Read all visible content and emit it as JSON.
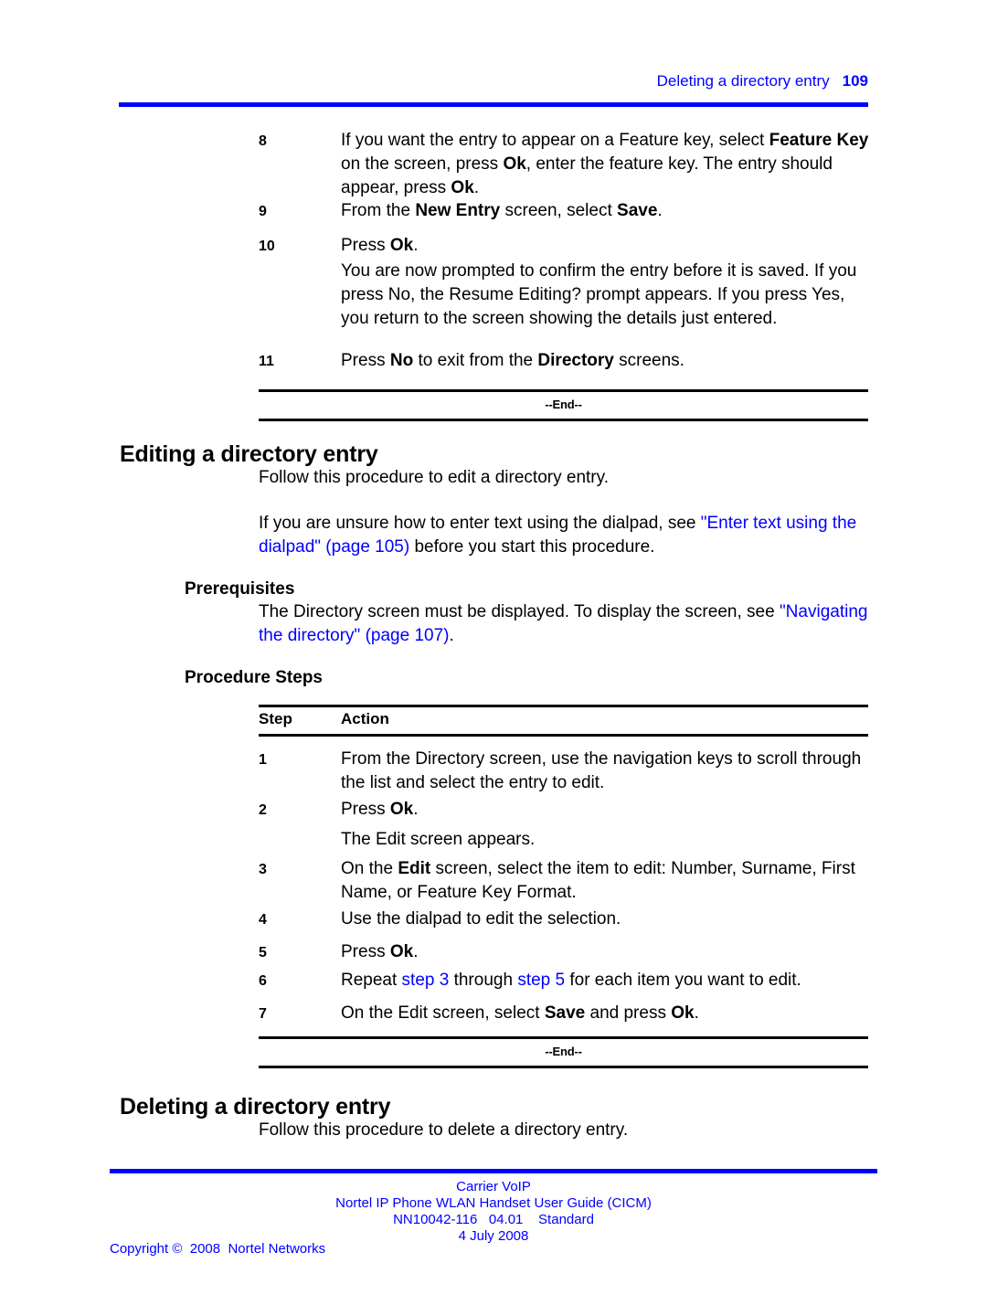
{
  "header": {
    "chapter_title": "Deleting a directory entry",
    "page_number": "109"
  },
  "continued_procedure": {
    "steps": [
      {
        "number": "8",
        "segments": [
          {
            "text": "If you want the entry to appear on a Feature key, select ",
            "style": "normal"
          },
          {
            "text": "Feature Key",
            "style": "bold"
          },
          {
            "text": " on the screen, press ",
            "style": "normal"
          },
          {
            "text": "Ok",
            "style": "bold"
          },
          {
            "text": ", enter the feature key. The entry should appear, press ",
            "style": "normal"
          },
          {
            "text": "Ok",
            "style": "bold"
          },
          {
            "text": ".",
            "style": "normal"
          }
        ]
      },
      {
        "number": "9",
        "segments": [
          {
            "text": "From the ",
            "style": "normal"
          },
          {
            "text": "New Entry",
            "style": "bold"
          },
          {
            "text": " screen, select ",
            "style": "normal"
          },
          {
            "text": "Save",
            "style": "bold"
          },
          {
            "text": ".",
            "style": "normal"
          }
        ]
      },
      {
        "number": "10",
        "segments": [
          {
            "text": "Press ",
            "style": "normal"
          },
          {
            "text": "Ok",
            "style": "bold"
          },
          {
            "text": ".",
            "style": "normal"
          }
        ]
      },
      {
        "number": "11",
        "segments": [
          {
            "text": "Press ",
            "style": "normal"
          },
          {
            "text": "No",
            "style": "bold"
          },
          {
            "text": " to exit from the ",
            "style": "normal"
          },
          {
            "text": "Directory",
            "style": "bold"
          },
          {
            "text": " screens.",
            "style": "normal"
          }
        ]
      }
    ],
    "step10_note": "You are now prompted to confirm the entry before it is saved. If you press No, the Resume Editing? prompt appears. If you press Yes, you return to the screen showing the details just entered.",
    "end_label": "--End--"
  },
  "editing_section": {
    "heading": "Editing a directory entry",
    "intro": "Follow this procedure to edit a directory entry.",
    "dialpad_note": {
      "lead": "If you are unsure how to enter text using the dialpad, see ",
      "link": "\"Enter text using the dialpad\" (page 105)",
      "tail": " before you start this procedure."
    },
    "prerequisites_heading": "Prerequisites",
    "prerequisites_text": {
      "lead": "The Directory screen must be displayed. To display the screen, see ",
      "link": "\"Navigating the directory\" (page 107)",
      "tail": "."
    },
    "procedure_heading": "Procedure Steps",
    "table": {
      "columns": [
        "Step",
        "Action"
      ],
      "rows": [
        {
          "number": "1",
          "segments": [
            {
              "text": "From the Directory screen, use the navigation keys to scroll through the list and select the entry to edit.",
              "style": "normal"
            }
          ]
        },
        {
          "number": "2",
          "segments": [
            {
              "text": "Press ",
              "style": "normal"
            },
            {
              "text": "Ok",
              "style": "bold"
            },
            {
              "text": ".",
              "style": "normal"
            }
          ]
        },
        {
          "number": "3",
          "segments": [
            {
              "text": "On the ",
              "style": "normal"
            },
            {
              "text": "Edit",
              "style": "bold"
            },
            {
              "text": " screen, select the item to edit: Number, Surname, First Name, or Feature Key Format.",
              "style": "normal"
            }
          ]
        },
        {
          "number": "4",
          "segments": [
            {
              "text": "Use the dialpad to edit the selection.",
              "style": "normal"
            }
          ]
        },
        {
          "number": "5",
          "segments": [
            {
              "text": "Press ",
              "style": "normal"
            },
            {
              "text": "Ok",
              "style": "bold"
            },
            {
              "text": ".",
              "style": "normal"
            }
          ]
        },
        {
          "number": "6",
          "segments": [
            {
              "text": "Repeat ",
              "style": "normal"
            },
            {
              "text": "step 3",
              "style": "link"
            },
            {
              "text": " through ",
              "style": "normal"
            },
            {
              "text": "step 5",
              "style": "link"
            },
            {
              "text": " for each item you want to edit.",
              "style": "normal"
            }
          ]
        },
        {
          "number": "7",
          "segments": [
            {
              "text": "On the Edit screen, select ",
              "style": "normal"
            },
            {
              "text": "Save",
              "style": "bold"
            },
            {
              "text": " and press ",
              "style": "normal"
            },
            {
              "text": "Ok",
              "style": "bold"
            },
            {
              "text": ".",
              "style": "normal"
            }
          ]
        }
      ]
    },
    "step2_note": "The Edit screen appears.",
    "end_label": "--End--"
  },
  "deleting_section": {
    "heading": "Deleting a directory entry",
    "intro": "Follow this procedure to delete a directory entry."
  },
  "footer": {
    "line1": "Carrier VoIP",
    "line2": "Nortel IP Phone WLAN Handset User Guide (CICM)",
    "line3": "NN10042-116   04.01    Standard",
    "line4": "4 July 2008",
    "copyright": "Copyright ©  2008  Nortel Networks"
  },
  "colors": {
    "link_blue": "#0000ff",
    "rule_black": "#000000",
    "page_background": "#ffffff"
  }
}
